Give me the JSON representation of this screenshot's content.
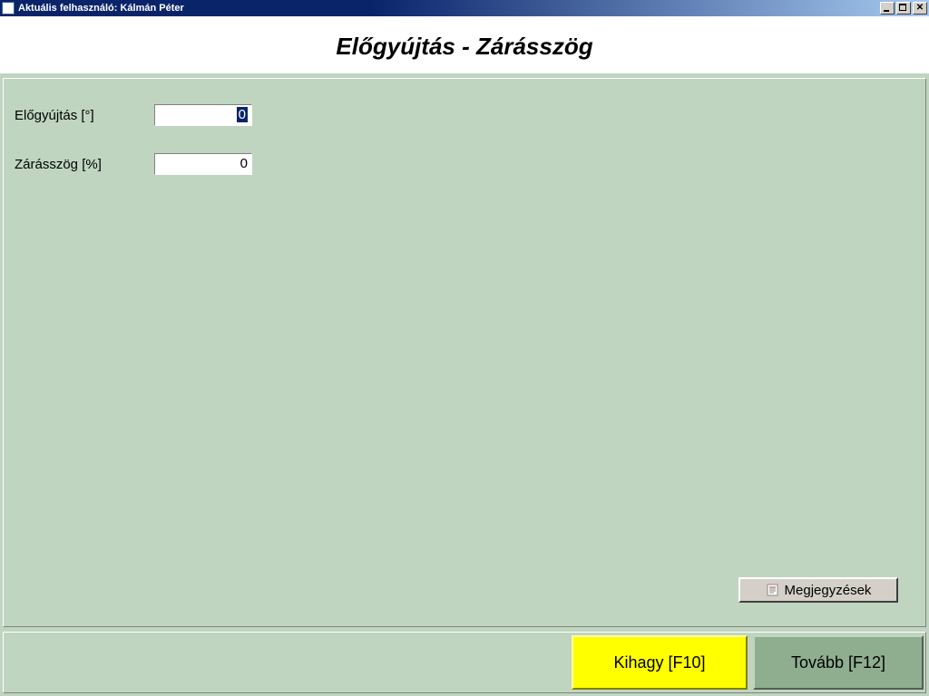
{
  "window": {
    "title": "Aktuális felhasználó: Kálmán Péter"
  },
  "header": {
    "title": "Előgyújtás - Zárásszög"
  },
  "form": {
    "rows": [
      {
        "label": "Előgyújtás [°]",
        "value": "0",
        "selected": true
      },
      {
        "label": "Zárásszög [%]",
        "value": "0",
        "selected": false
      }
    ]
  },
  "buttons": {
    "notes": "Megjegyzések",
    "skip": "Kihagy [F10]",
    "next": "Tovább [F12]"
  }
}
